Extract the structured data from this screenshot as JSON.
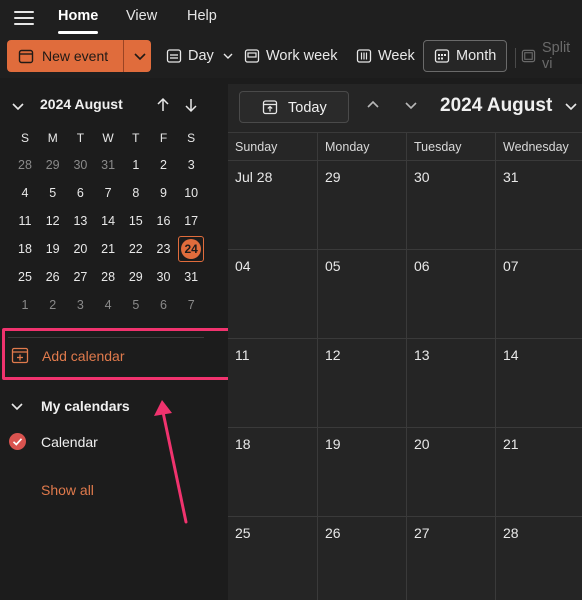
{
  "menu": {
    "tabs": [
      {
        "label": "Home",
        "active": true
      },
      {
        "label": "View",
        "active": false
      },
      {
        "label": "Help",
        "active": false
      }
    ]
  },
  "toolbar": {
    "new_event": "New event",
    "day": "Day",
    "work_week": "Work week",
    "week": "Week",
    "month": "Month",
    "split_view": "Split vi",
    "accent_color": "#e06c3c"
  },
  "mini_calendar": {
    "title": "2024 August",
    "weekdays": [
      "S",
      "M",
      "T",
      "W",
      "T",
      "F",
      "S"
    ],
    "weeks": [
      [
        "28",
        "29",
        "30",
        "31",
        "1",
        "2",
        "3"
      ],
      [
        "4",
        "5",
        "6",
        "7",
        "8",
        "9",
        "10"
      ],
      [
        "11",
        "12",
        "13",
        "14",
        "15",
        "16",
        "17"
      ],
      [
        "18",
        "19",
        "20",
        "21",
        "22",
        "23",
        "24"
      ],
      [
        "25",
        "26",
        "27",
        "28",
        "29",
        "30",
        "31"
      ],
      [
        "1",
        "2",
        "3",
        "4",
        "5",
        "6",
        "7"
      ]
    ],
    "today": "24"
  },
  "sidebar": {
    "add_calendar": "Add calendar",
    "my_calendars": "My calendars",
    "calendar_item": "Calendar",
    "show_all": "Show all",
    "highlight_color": "#f0336e"
  },
  "main": {
    "today_button": "Today",
    "title": "2024 August",
    "weekdays": [
      "Sunday",
      "Monday",
      "Tuesday",
      "Wednesday"
    ],
    "weeks": [
      [
        "Jul 28",
        "29",
        "30",
        "31"
      ],
      [
        "04",
        "05",
        "06",
        "07"
      ],
      [
        "11",
        "12",
        "13",
        "14"
      ],
      [
        "18",
        "19",
        "20",
        "21"
      ],
      [
        "25",
        "26",
        "27",
        "28"
      ]
    ]
  }
}
